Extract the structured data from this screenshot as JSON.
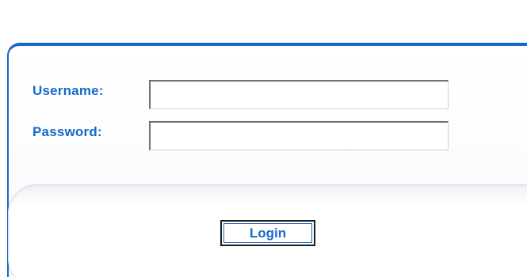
{
  "login_form": {
    "username_label": "Username:",
    "password_label": "Password:",
    "username_value": "",
    "password_value": "",
    "login_button_label": "Login"
  },
  "colors": {
    "accent": "#1a68c8",
    "button_border": "#1c1c1c"
  }
}
